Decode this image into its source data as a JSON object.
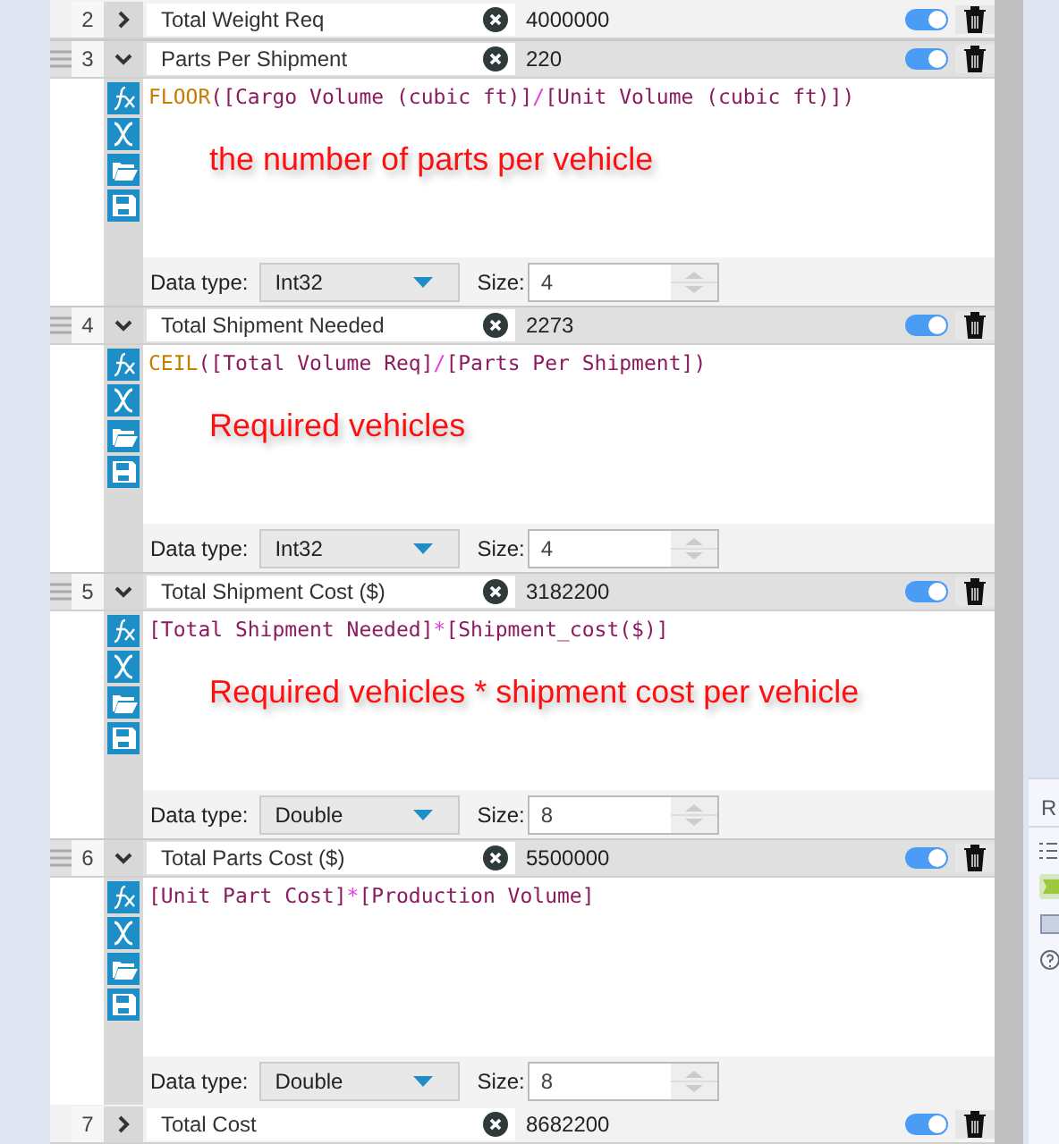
{
  "rows": [
    {
      "number": "2",
      "name": "Total Weight Req",
      "value": "4000000",
      "expanded": false,
      "enabled": true
    },
    {
      "number": "3",
      "name": "Parts Per Shipment",
      "value": "220",
      "expanded": true,
      "enabled": true,
      "formula": [
        {
          "kind": "func",
          "text": "FLOOR"
        },
        {
          "kind": "paren",
          "text": "("
        },
        {
          "kind": "field",
          "text": "[Cargo Volume (cubic ft)]"
        },
        {
          "kind": "op",
          "text": "/"
        },
        {
          "kind": "field",
          "text": "[Unit Volume (cubic ft)]"
        },
        {
          "kind": "paren",
          "text": ")"
        }
      ],
      "note": "the number of parts per vehicle",
      "data_type_label": "Data type:",
      "data_type": "Int32",
      "size_label": "Size:",
      "size": "4"
    },
    {
      "number": "4",
      "name": "Total Shipment Needed",
      "value": "2273",
      "expanded": true,
      "enabled": true,
      "formula": [
        {
          "kind": "func",
          "text": "CEIL"
        },
        {
          "kind": "paren",
          "text": "("
        },
        {
          "kind": "field",
          "text": "[Total Volume Req]"
        },
        {
          "kind": "op",
          "text": "/"
        },
        {
          "kind": "field",
          "text": "[Parts Per Shipment]"
        },
        {
          "kind": "paren",
          "text": ")"
        }
      ],
      "note": "Required vehicles",
      "data_type_label": "Data type:",
      "data_type": "Int32",
      "size_label": "Size:",
      "size": "4"
    },
    {
      "number": "5",
      "name": "Total Shipment Cost ($)",
      "value": "3182200",
      "expanded": true,
      "enabled": true,
      "formula": [
        {
          "kind": "field",
          "text": "[Total Shipment Needed]"
        },
        {
          "kind": "op",
          "text": "*"
        },
        {
          "kind": "field",
          "text": "[Shipment_cost($)]"
        }
      ],
      "note": "Required vehicles * shipment cost per vehicle",
      "data_type_label": "Data type:",
      "data_type": "Double",
      "size_label": "Size:",
      "size": "8"
    },
    {
      "number": "6",
      "name": "Total Parts Cost ($)",
      "value": "5500000",
      "expanded": true,
      "enabled": true,
      "formula": [
        {
          "kind": "field",
          "text": "[Unit Part Cost]"
        },
        {
          "kind": "op",
          "text": "*"
        },
        {
          "kind": "field",
          "text": "[Production Volume]"
        }
      ],
      "data_type_label": "Data type:",
      "data_type": "Double",
      "size_label": "Size:",
      "size": "8"
    },
    {
      "number": "7",
      "name": "Total Cost",
      "value": "8682200",
      "expanded": false,
      "enabled": true
    }
  ],
  "side_panel": {
    "heading": "R"
  }
}
